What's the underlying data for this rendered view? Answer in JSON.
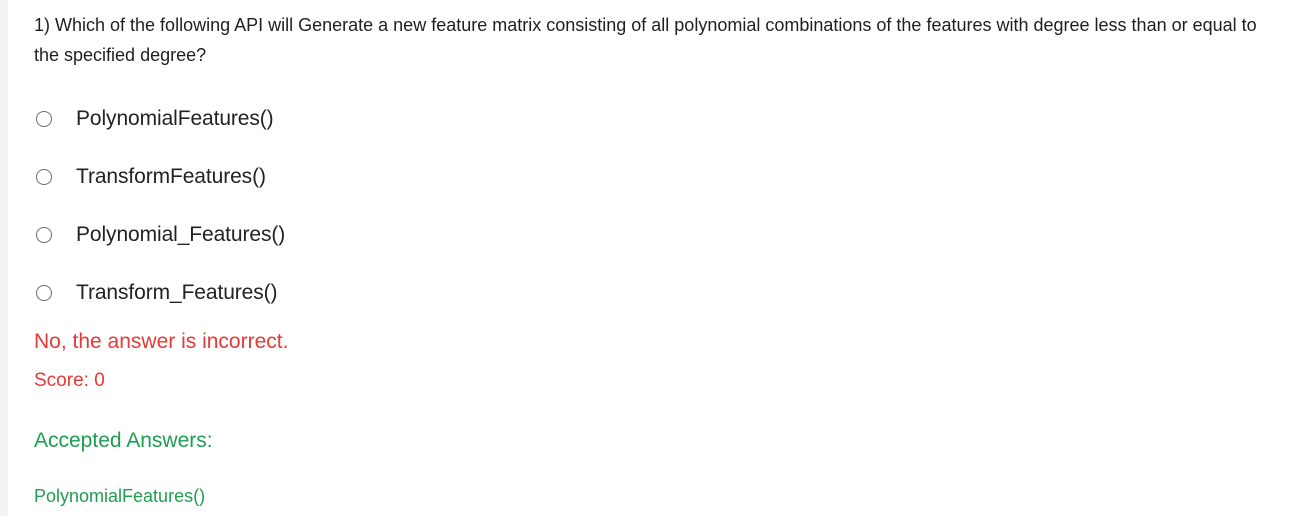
{
  "question": {
    "text": "1) Which of the following API will Generate a new feature matrix consisting of all polynomial combinations of the features with degree less than or equal to the specified degree?"
  },
  "options": [
    {
      "label": "PolynomialFeatures()",
      "selected": false
    },
    {
      "label": "TransformFeatures()",
      "selected": false
    },
    {
      "label": "Polynomial_Features()",
      "selected": false
    },
    {
      "label": "Transform_Features()",
      "selected": false
    }
  ],
  "result": {
    "feedback": "No, the answer is incorrect.",
    "score": "Score: 0"
  },
  "accepted": {
    "title": "Accepted Answers:",
    "answers": [
      "PolynomialFeatures()"
    ]
  },
  "colors": {
    "incorrect": "#e53935",
    "accepted": "#1e9e4f",
    "text": "#1f1f1f"
  }
}
